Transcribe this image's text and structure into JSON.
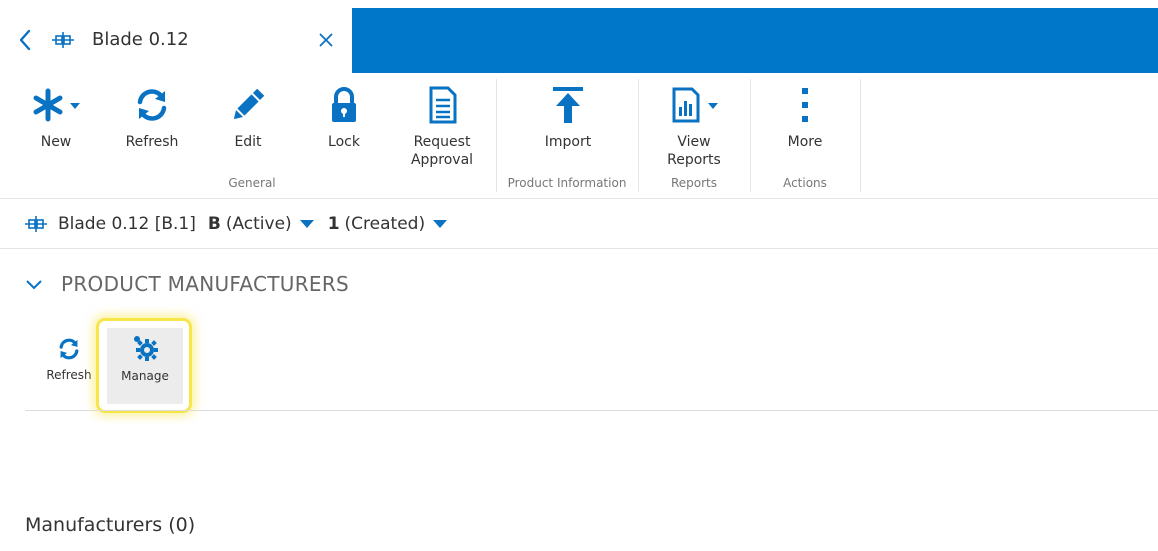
{
  "tab": {
    "title": "Blade 0.12",
    "accent": "#0077c8"
  },
  "ribbon": {
    "buttons": {
      "new": "New",
      "refresh": "Refresh",
      "edit": "Edit",
      "lock": "Lock",
      "request_approval": "Request\nApproval",
      "import": "Import",
      "view_reports": "View\nReports",
      "more": "More"
    },
    "groups": {
      "general": "General",
      "product_information": "Product Information",
      "reports": "Reports",
      "actions": "Actions"
    }
  },
  "breadcrumb": {
    "item": "Blade 0.12 [B.1]",
    "revision": "B",
    "revision_state": "(Active)",
    "iteration": "1",
    "iteration_state": "(Created)"
  },
  "section": {
    "title": "PRODUCT MANUFACTURERS",
    "refresh_label": "Refresh",
    "manage_label": "Manage",
    "highlight_color": "#f7e64a"
  },
  "manufacturers": {
    "label": "Manufacturers (0)"
  },
  "icons": {
    "back": "chevron-left-icon",
    "part": "part-structure-icon",
    "close": "close-icon",
    "new": "asterisk-icon",
    "refresh": "refresh-icon",
    "edit": "pencil-icon",
    "lock": "lock-icon",
    "request_approval": "document-icon",
    "import": "upload-icon",
    "view_reports": "report-icon",
    "more": "more-vertical-icon",
    "manage": "gears-icon",
    "collapse": "chevron-down-icon"
  }
}
